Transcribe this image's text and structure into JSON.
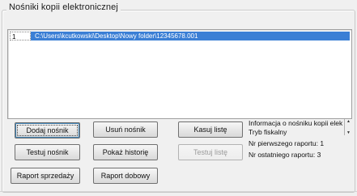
{
  "window": {
    "group_title": "Nośniki kopii elektronicznej"
  },
  "list": {
    "rows": [
      {
        "index": "1",
        "path": "C:\\Users\\kcutkowski\\Desktop\\Nowy folder\\12345678.001"
      }
    ]
  },
  "buttons": {
    "add": "Dodaj nośnik",
    "remove": "Usuń nośnik",
    "clear_list": "Kasuj listę",
    "test": "Testuj nośnik",
    "history": "Pokaż historię",
    "test_list": "Testuj listę",
    "sales_report": "Raport sprzedaży",
    "daily_report": "Raport dobowy"
  },
  "info": {
    "line1": "Informacja o nośniku kopii elektronicznej",
    "line2": "Tryb fiskalny",
    "line3": "Nr pierwszego raportu: 1",
    "line4": "Nr ostatniego raportu: 3",
    "scroll_up": "▲",
    "scroll_down": "▼"
  }
}
